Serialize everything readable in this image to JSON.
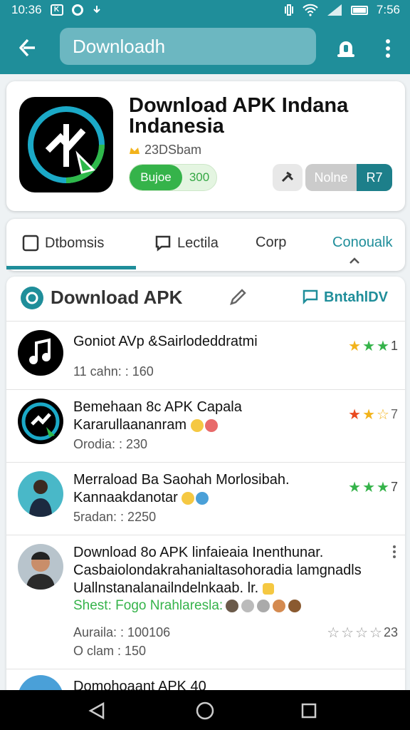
{
  "status_bar": {
    "time_left": "10:36",
    "time_right": "7:56"
  },
  "search": {
    "placeholder": "Downloadh"
  },
  "app": {
    "title_line1": "Download APK Indana",
    "title_line2": "Indanesia",
    "rating_text": "23DSbam",
    "primary_button": {
      "label_left": "Bujoe",
      "label_right": "300"
    },
    "action_button": {
      "label": "Nolne",
      "badge": "R7"
    }
  },
  "tabs": [
    {
      "label": "Dtbomsis"
    },
    {
      "label": "Lectila"
    },
    {
      "label": "Corp"
    },
    {
      "label": "Conoualk"
    }
  ],
  "list_header": {
    "title": "Download APK",
    "link": "BntahlDV"
  },
  "items": [
    {
      "title": "Goniot AVp &Sairlodeddratmi",
      "meta": "11 cahn: : 160",
      "rating": "1",
      "stars_colored": 3,
      "star_color": "#f2b31b"
    },
    {
      "title": "Bemehaan 8c APK Capala",
      "title2": "Kararullaananram",
      "meta": "Orodia: : 230",
      "rating": "7",
      "stars_colored": 2,
      "star_color": "#e94a20"
    },
    {
      "title": "Merraload Ba Saohah Morlosibah.",
      "title2": "Kannaakdanotar",
      "meta": "5radan: : 2250",
      "rating": "7",
      "stars_colored": 3,
      "star_color": "#35b34a"
    },
    {
      "title": "Download 8o APK linfaieaia Inenthunar.",
      "title2": "Casbaiolondakrahanialtasohoradia lamgnadls",
      "title3": "Uallnstanalanailndelnkaab. lr.",
      "tags": "Shest: Fogo Nrahlaresla:",
      "meta": "Auraila: : 100106",
      "meta2": "O clam : 150",
      "rating": "23",
      "stars_colored": 0,
      "star_color": "#999999"
    },
    {
      "title": "Domohoaant APK 40"
    }
  ],
  "colors": {
    "accent": "#1f8e9a",
    "green": "#35b34a",
    "star_gold": "#f2b31b",
    "star_red": "#e94a20"
  }
}
